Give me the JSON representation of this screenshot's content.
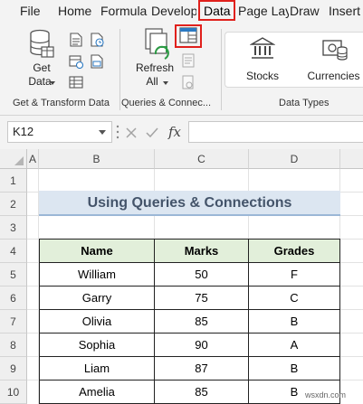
{
  "tabs": [
    {
      "label": "File",
      "active": false
    },
    {
      "label": "Home",
      "active": false
    },
    {
      "label": "Formula",
      "active": false
    },
    {
      "label": "Develop",
      "active": false
    },
    {
      "label": "Data",
      "active": true
    },
    {
      "label": "Page Lay",
      "active": false
    },
    {
      "label": "Draw",
      "active": false
    },
    {
      "label": "Insert",
      "active": false
    }
  ],
  "ribbon": {
    "get_transform": {
      "get_data_label_1": "Get",
      "get_data_label_2": "Data",
      "group_label": "Get & Transform Data"
    },
    "queries": {
      "refresh_label_1": "Refresh",
      "refresh_label_2": "All",
      "group_label": "Queries & Connec..."
    },
    "data_types": {
      "stocks_label": "Stocks",
      "currencies_label": "Currencies",
      "group_label": "Data Types"
    }
  },
  "formula_bar": {
    "name_box": "K12",
    "fx": "fx",
    "formula": ""
  },
  "columns": [
    "A",
    "B",
    "C",
    "D"
  ],
  "rows": [
    "1",
    "2",
    "3",
    "4",
    "5",
    "6",
    "7",
    "8",
    "9",
    "10"
  ],
  "sheet": {
    "title": "Using Queries & Connections",
    "table": {
      "headers": [
        "Name",
        "Marks",
        "Grades"
      ],
      "rows": [
        [
          "William",
          "50",
          "F"
        ],
        [
          "Garry",
          "75",
          "C"
        ],
        [
          "Olivia",
          "85",
          "B"
        ],
        [
          "Sophia",
          "90",
          "A"
        ],
        [
          "Liam",
          "87",
          "B"
        ],
        [
          "Amelia",
          "85",
          "B"
        ]
      ]
    }
  },
  "watermark": "wsxdn.com",
  "colors": {
    "highlight": "#e0201c",
    "title_fill": "#dce6f1",
    "header_fill": "#e2efda",
    "ribbon_bg": "#f3f3f3"
  }
}
